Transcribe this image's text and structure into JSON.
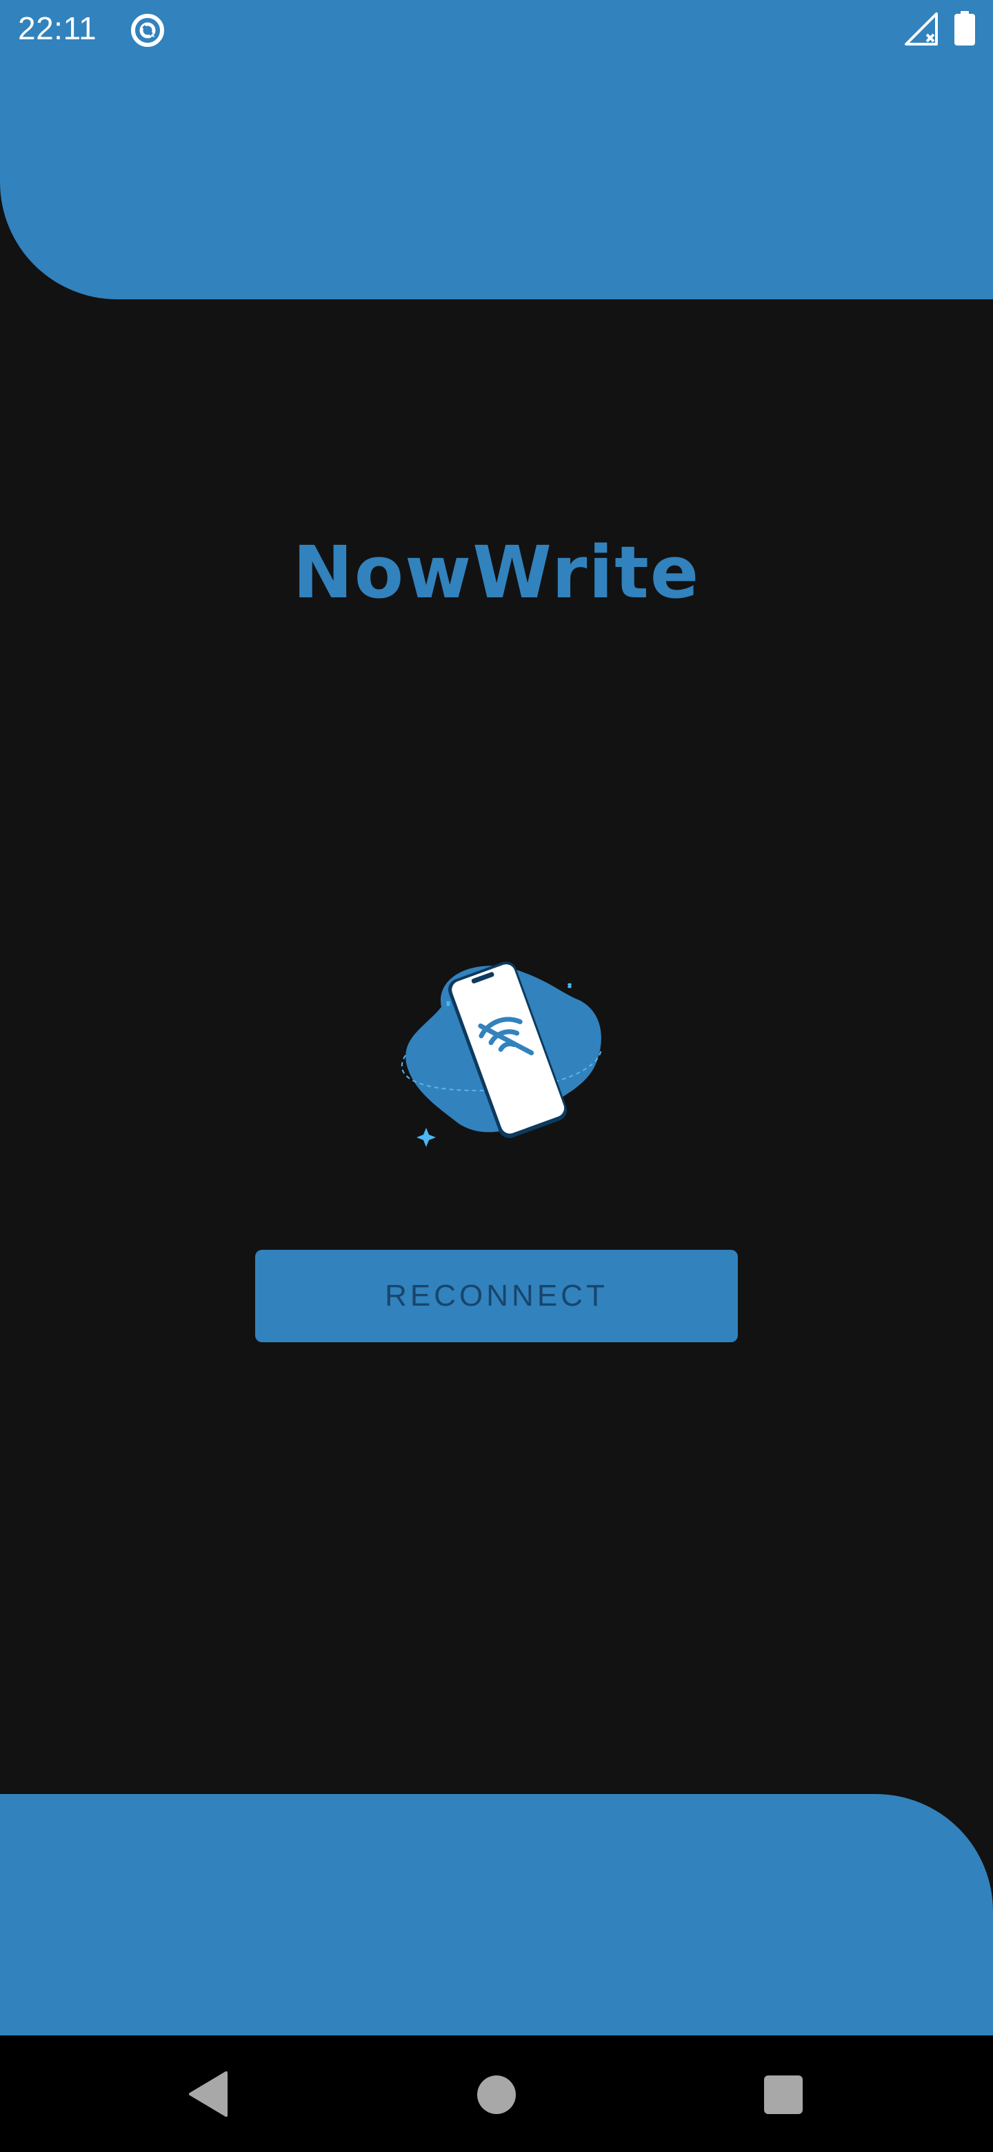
{
  "status_bar": {
    "time": "22:11",
    "app_icon": "sync-badge-icon",
    "signal_icon": "signal-no-service-icon",
    "battery_icon": "battery-full-icon"
  },
  "app": {
    "title": "NowWrite",
    "illustration_icon": "phone-no-connection-illustration",
    "accent_color": "#3282BD",
    "background_color": "#121212"
  },
  "actions": {
    "reconnect_label": "RECONNECT"
  },
  "navigation": {
    "back_icon": "back-triangle-icon",
    "home_icon": "home-circle-icon",
    "recents_icon": "recents-square-icon"
  }
}
